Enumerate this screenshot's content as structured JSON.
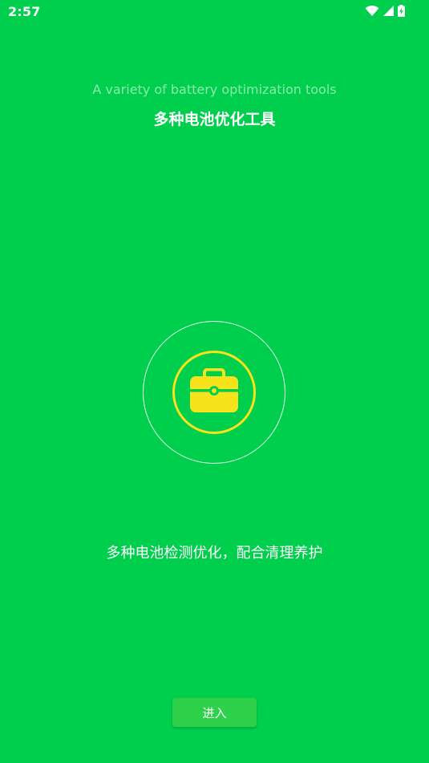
{
  "status_bar": {
    "time": "2:57",
    "icons": [
      "wifi-icon",
      "cellular-signal-icon",
      "battery-charging-icon"
    ]
  },
  "header": {
    "subtitle": "A variety of battery optimization tools",
    "title": "多种电池优化工具"
  },
  "hero": {
    "icon": "toolbox-icon",
    "accent_color": "#f7e21b"
  },
  "description": "多种电池检测优化，配合清理养护",
  "enter_button": {
    "label": "进入"
  },
  "colors": {
    "background": "#00cf4d",
    "button": "#2fd14a"
  }
}
